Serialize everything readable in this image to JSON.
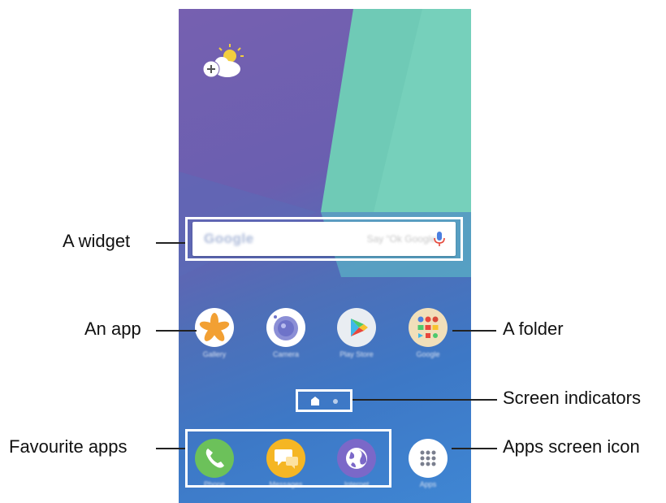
{
  "callouts": {
    "widget": "A widget",
    "app": "An app",
    "folder": "A folder",
    "screen_indicators": "Screen indicators",
    "favourite_apps": "Favourite apps",
    "apps_screen_icon": "Apps screen icon"
  },
  "search_widget": {
    "logo_text": "Google",
    "hint_text": "Say “Ok Google”"
  },
  "apps_row": [
    {
      "label": "Gallery",
      "icon": "gallery-flower-icon",
      "color": "#f2a033"
    },
    {
      "label": "Camera",
      "icon": "camera-lens-icon",
      "color": "#6e73c9"
    },
    {
      "label": "Play Store",
      "icon": "play-store-icon",
      "color": "#e9edf2"
    },
    {
      "label": "Google",
      "icon": "google-folder-icon",
      "color": "#f1dfba"
    }
  ],
  "dock": [
    {
      "label": "Phone",
      "icon": "phone-handset-icon",
      "color": "#6cc15a"
    },
    {
      "label": "Messages",
      "icon": "message-bubbles-icon",
      "color": "#f5b624"
    },
    {
      "label": "Internet",
      "icon": "internet-globe-icon",
      "color": "#7b68c8"
    },
    {
      "label": "Apps",
      "icon": "apps-grid-icon",
      "color": "#ffffff"
    }
  ],
  "colors": {
    "wallpaper_purple": "#7660b0",
    "wallpaper_teal": "#73cdb8",
    "wallpaper_blue": "#3f86d3",
    "highlight": "#ffffff"
  }
}
